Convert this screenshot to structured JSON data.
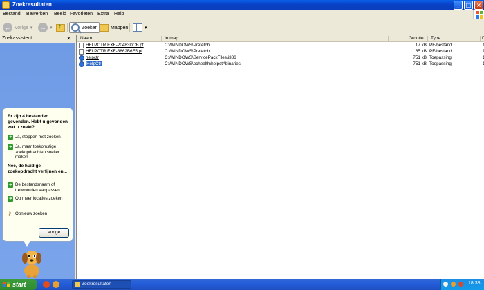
{
  "window": {
    "title": "Zoekresultaten"
  },
  "menu": [
    "Bestand",
    "Bewerken",
    "Beeld",
    "Favorieten",
    "Extra",
    "Help"
  ],
  "toolbar": {
    "back_label": "Vorige",
    "search_label": "Zoeken",
    "folders_label": "Mappen"
  },
  "left_panel": {
    "title": "Zoekassistent",
    "close_glyph": "×",
    "intro": "Er zijn 4 bestanden gevonden. Hebt u gevonden wat u zoekt?",
    "options_yes": [
      "Ja, stoppen met zoeken",
      "Ja, maar toekomstige zoekopdrachten sneller maken"
    ],
    "refine_title": "Nee, de huidige zoekopdracht verfijnen en...",
    "options_refine": [
      "De bestandsnaam of trefwoorden aanpassen",
      "Op meer locaties zoeken"
    ],
    "search_again": "Opnieuw zoeken",
    "back_button": "Vorige"
  },
  "table": {
    "columns": [
      "Naam",
      "In map",
      "Grootte",
      "Type",
      "D"
    ],
    "rows": [
      {
        "name": "HELPCTR.EXE-20483DCB.pf",
        "folder": "C:\\WINDOWS\\Prefetch",
        "size": "17 kB",
        "type": "PF-bestand",
        "date": "1",
        "icon": "file-icon",
        "selected": false
      },
      {
        "name": "HELPCTR.EXE-3862B6F5.pf",
        "folder": "C:\\WINDOWS\\Prefetch",
        "size": "65 kB",
        "type": "PF-bestand",
        "date": "1",
        "icon": "file-icon",
        "selected": false
      },
      {
        "name": "helpctr",
        "folder": "C:\\WINDOWS\\ServicePackFiles\\i386",
        "size": "751 kB",
        "type": "Toepassing",
        "date": "1",
        "icon": "help-center-icon",
        "selected": false
      },
      {
        "name": "HelpCtr",
        "folder": "C:\\WINDOWS\\pchealth\\helpctr\\binaries",
        "size": "751 kB",
        "type": "Toepassing",
        "date": "1",
        "icon": "help-center-icon",
        "selected": true
      }
    ]
  },
  "taskbar": {
    "start_label": "start",
    "task_label": "Zoekresultaten",
    "clock": "18:38"
  }
}
